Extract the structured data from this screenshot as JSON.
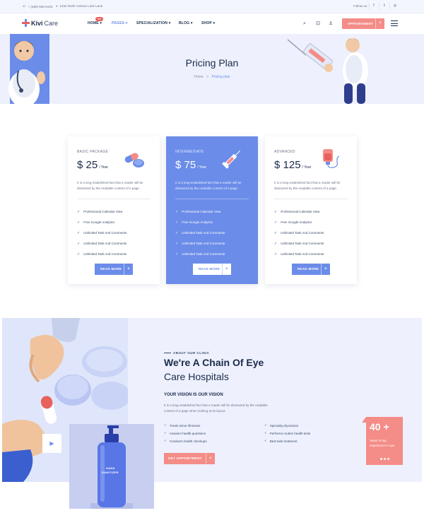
{
  "topbar": {
    "phone": "+ (480) 555-0103",
    "address": "1234 North Avenue Luke Lane",
    "follow_label": "Follow us :"
  },
  "header": {
    "logo_kivi": "Kivi",
    "logo_care": "Care",
    "nav": [
      "HOME",
      "PAGES",
      "SPECIALIZATION",
      "BLOG",
      "SHOP"
    ],
    "nav_active_index": 1,
    "hot_badge": "Hot",
    "appointment_label": "APPOINTMENT",
    "plus": "+"
  },
  "hero": {
    "title": "Pricing Plan",
    "crumb_home": "Home",
    "crumb_sep": ">",
    "crumb_current": "Pricing plan"
  },
  "plans": [
    {
      "name": "BASIC PACKAGE",
      "currency": "$",
      "amount": "25",
      "period": "/ Year",
      "description": "It is a long established fact that a reader will be distracted by the readable content of a page.",
      "features": [
        "Professional Calendar View",
        "Free Google Analytics",
        "Unlimited Task And Comments",
        "Unlimited Task And Comments",
        "Unlimited Task And Comments"
      ],
      "button": "READ MORE",
      "icon": "pills-icon"
    },
    {
      "name": "INTERMEDIATE",
      "currency": "$",
      "amount": "75",
      "period": "/ Year",
      "description": "It is a long established fact that a reader will be distracted by the readable content of a page.",
      "features": [
        "Professional Calendar View",
        "Free Google Analytics",
        "Unlimited Task And Comments",
        "Unlimited Task And Comments",
        "Unlimited Task And Comments"
      ],
      "button": "READ MORE",
      "icon": "syringe-icon"
    },
    {
      "name": "ADVANCED",
      "currency": "$",
      "amount": "125",
      "period": "/ Year",
      "description": "It is a long established fact that a reader will be distracted by the readable content of a page.",
      "features": [
        "Professional Calendar View",
        "Free Google Analytics",
        "Unlimited Task And Comments",
        "Unlimited Task And Comments",
        "Unlimited Task And Comments"
      ],
      "button": "READ MORE",
      "icon": "iv-bag-icon"
    }
  ],
  "about": {
    "sub_label": "ABOUT OUR CLINIC",
    "title_line1": "We're A Chain Of Eye",
    "title_line2": "Care Hospitals",
    "vision_heading": "YOUR VISION IS OUR VISION",
    "description": "It is a long established fact that a reader will be distracted by the readable content of a page when looking at its layout.",
    "features_left": [
      "Treats minor illnesses",
      "Answers health questions",
      "Conducts health checkups"
    ],
    "features_right": [
      "Specialty physicians",
      "Performs routine health tests",
      "Best task treatment"
    ],
    "button": "GET APPOINTMENT",
    "experience_number": "40 +",
    "experience_label": "Years of top experience in eye",
    "bottle_text_1": "HAND",
    "bottle_text_2": "SANITIZER"
  },
  "colors": {
    "primary": "#6b8ce8",
    "accent": "#f48c87",
    "dark": "#1b2b4b",
    "light_bg": "#eef1fd"
  }
}
